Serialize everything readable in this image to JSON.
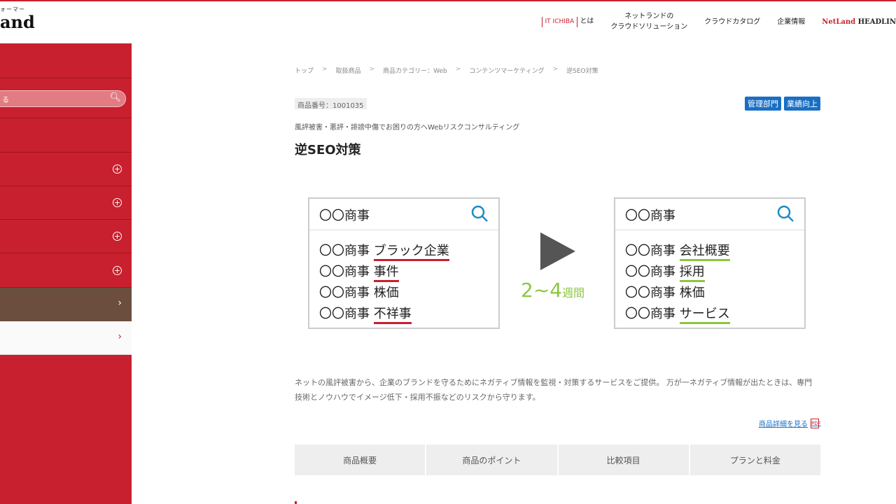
{
  "header": {
    "logo_tag": "ォーマー",
    "logo_brand": "and",
    "nav": {
      "ichiba_box": "IT ICHIBA",
      "ichiba_suffix": "とは",
      "solution_line1": "ネットランドの",
      "solution_line2": "クラウドソリューション",
      "catalog": "クラウドカタログ",
      "company": "企業情報",
      "netland_red": "NetLand",
      "netland_black": " HEADLIN"
    }
  },
  "sidebar": {
    "search_placeholder": "る"
  },
  "breadcrumb": [
    "トップ",
    "取扱商品",
    "商品カテゴリー：Web",
    "コンテンツマーケティング",
    "逆SEO対策"
  ],
  "product": {
    "id_label": "商品番号：1001035",
    "tags": [
      "管理部門",
      "業績向上"
    ],
    "subtitle": "風評被害・悪評・誹謗中傷でお困りの方へWebリスクコンサルティング",
    "title": "逆SEO対策"
  },
  "illustration": {
    "query": "〇〇商事",
    "prefix": "〇〇商事 ",
    "before": [
      "ブラック企業",
      "事件",
      "株価",
      "不祥事"
    ],
    "after": [
      "会社概要",
      "採用",
      "株価",
      "サービス"
    ],
    "weeks_num": "2~4",
    "weeks_unit": "週間"
  },
  "description": "ネットの風評被害から、企業のブランドを守るためにネガティブ情報を監視・対策するサービスをご提供。 万が一ネガティブ情報が出たときは、専門技術とノウハウでイメージ低下・採用不振などのリスクから守ります。",
  "detail_link": "商品詳細を見る",
  "tabs": [
    "商品概要",
    "商品のポイント",
    "比較項目",
    "プランと料金"
  ]
}
